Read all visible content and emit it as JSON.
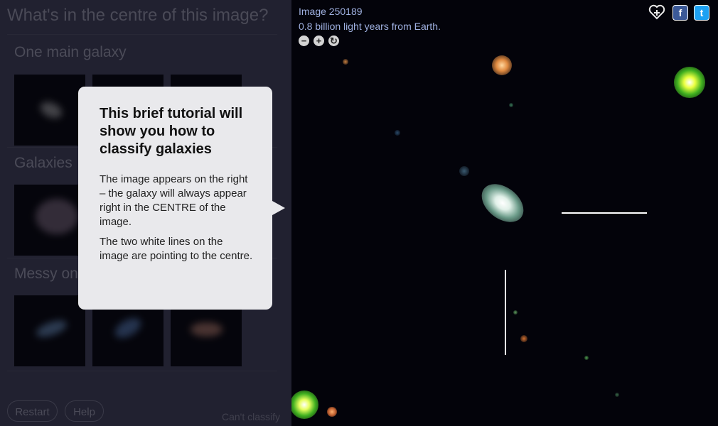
{
  "left_panel": {
    "question": "What's in the centre of this image?",
    "sections": [
      "One main galaxy",
      "Galaxies",
      "Messy on"
    ],
    "restart_label": "Restart",
    "help_label": "Help",
    "cant_classify_label": "Can't classify"
  },
  "image_info": {
    "id_text": "Image 250189",
    "distance_text": "0.8 billion light years from Earth."
  },
  "toolbar": {
    "zoom_out": "−",
    "zoom_in": "+",
    "reset": "↻",
    "facebook": "f",
    "twitter": "t"
  },
  "tutorial": {
    "title": "This brief tutorial will show you how to classify galaxies",
    "paragraph1": "The image appears on the right – the galaxy will always appear right in the CENTRE of the image.",
    "paragraph2": "The two white lines on the image are pointing to the centre."
  },
  "icons": [
    "favourite-icon",
    "zoom-out-icon",
    "zoom-in-icon",
    "reset-icon",
    "facebook-icon",
    "twitter-icon"
  ]
}
